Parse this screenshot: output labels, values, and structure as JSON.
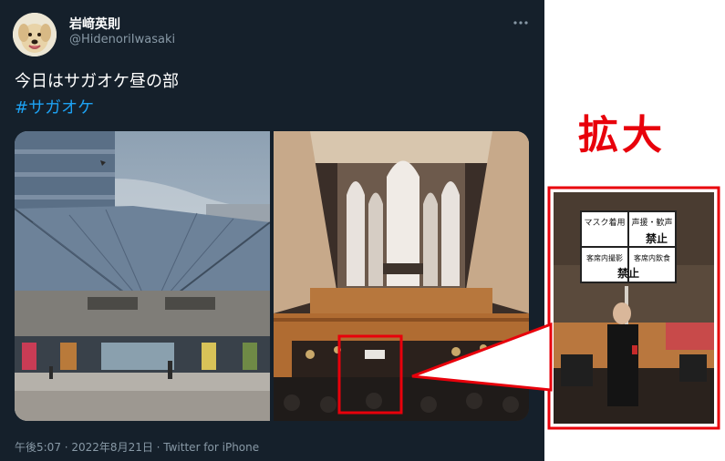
{
  "user": {
    "display_name": "岩﨑英則",
    "handle": "@HidenoriIwasaki"
  },
  "tweet": {
    "text": "今日はサガオケ昼の部",
    "hashtag": "#サガオケ",
    "footer": "午後5:07 · 2022年8月21日 · Twitter for iPhone"
  },
  "media": {
    "left_photo": "concert-hall-exterior",
    "right_photo": "concert-hall-interior-organ"
  },
  "overlay": {
    "zoom_label": "拡大",
    "sign_lines": [
      "マスク着用",
      "声援・歓声",
      "禁止",
      "客席内撮影",
      "客席内飲食",
      "禁止"
    ]
  },
  "colors": {
    "background": "#15202b",
    "hashtag": "#1da1f2",
    "accent_red": "#e8000b",
    "secondary_text": "#8899a6"
  },
  "icons": [
    "more-icon"
  ]
}
